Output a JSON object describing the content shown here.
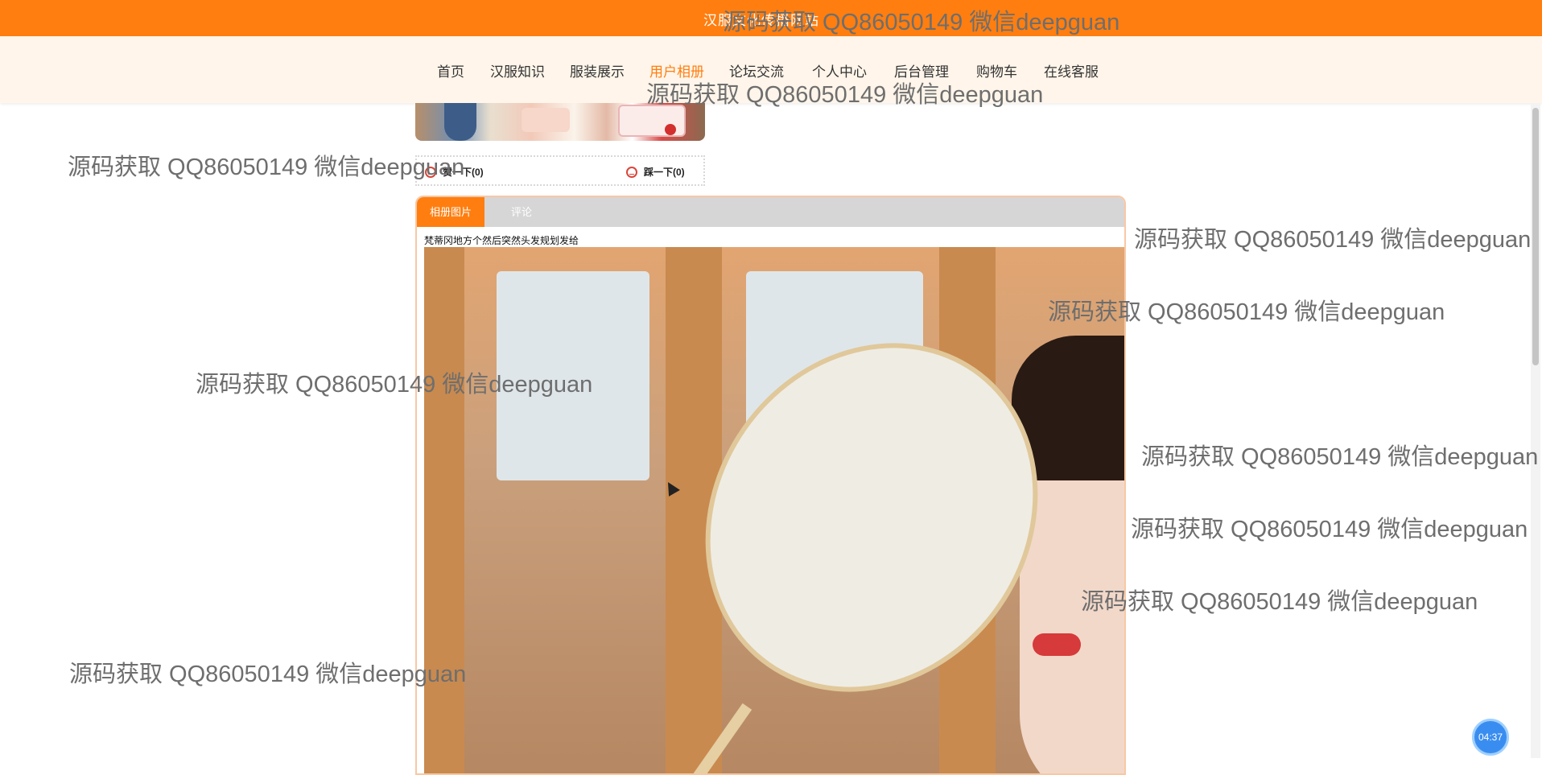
{
  "site_title": "汉服文化传播网站",
  "nav": [
    {
      "label": "首页",
      "active": false
    },
    {
      "label": "汉服知识",
      "active": false
    },
    {
      "label": "服装展示",
      "active": false
    },
    {
      "label": "用户相册",
      "active": true
    },
    {
      "label": "论坛交流",
      "active": false
    },
    {
      "label": "个人中心",
      "active": false
    },
    {
      "label": "后台管理",
      "active": false
    },
    {
      "label": "购物车",
      "active": false
    },
    {
      "label": "在线客服",
      "active": false
    }
  ],
  "votes": {
    "up_label": "赞一下(0)",
    "down_label": "踩一下(0)",
    "icon": "smiley-face-icon"
  },
  "tabs": [
    {
      "label": "相册图片",
      "active": true
    },
    {
      "label": "评论",
      "active": false
    }
  ],
  "album": {
    "description": "梵蒂冈地方个然后突然头发规划发给"
  },
  "timer": "04:37",
  "watermark_text": "源码获取 QQ86050149 微信deepguan",
  "colors": {
    "accent": "#ff7e0f",
    "nav_bg": "#fff5ea",
    "tab_bar": "#d6d6d6",
    "watermark": "#6e6e6e"
  }
}
